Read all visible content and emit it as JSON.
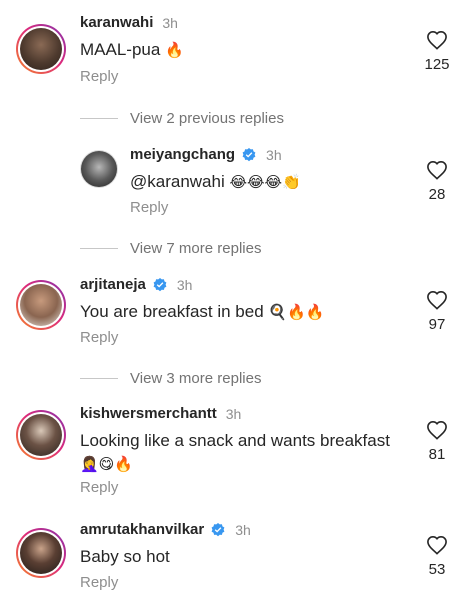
{
  "comments": [
    {
      "username": "karanwahi",
      "verified": false,
      "time": "3h",
      "text": "MAAL-pua",
      "emoji": "🔥",
      "reply_label": "Reply",
      "likes": "125"
    },
    {
      "username": "meiyangchang",
      "verified": true,
      "time": "3h",
      "text": "@karanwahi",
      "emoji": "😂😂😂👏",
      "reply_label": "Reply",
      "likes": "28"
    },
    {
      "username": "arjitaneja",
      "verified": true,
      "time": "3h",
      "text": "You are breakfast in bed",
      "emoji": "🍳🔥🔥",
      "reply_label": "Reply",
      "likes": "97"
    },
    {
      "username": "kishwersmerchantt",
      "verified": false,
      "time": "3h",
      "text": "Looking like a snack and wants breakfast",
      "text_line2_emoji": "🤦‍♀️😋🔥",
      "reply_label": "Reply",
      "likes": "81"
    },
    {
      "username": "amrutakhanvilkar",
      "verified": true,
      "time": "3h",
      "text": "Baby so hot",
      "reply_label": "Reply",
      "likes": "53"
    }
  ],
  "thread_links": [
    {
      "label": "View 2 previous replies"
    },
    {
      "label": "View 7 more replies"
    },
    {
      "label": "View 3 more replies"
    }
  ],
  "colors": {
    "verified_badge": "#3897f0",
    "secondary_text": "#8e8e8e"
  }
}
